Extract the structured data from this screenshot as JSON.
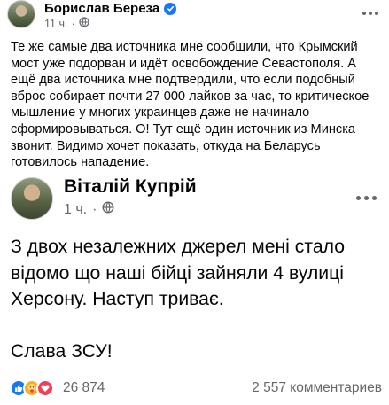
{
  "outer_post": {
    "author": "Борислав Береза",
    "time": "11 ч.",
    "text": "Те же самые два источника мне сообщили, что Крымский мост уже подорван и идёт освобождение Севастополя. А ещё два источника мне подтвердили, что если подобный вброс собирает почти 27 000 лайков за час, то критическое мышление у многих украинцев даже не начинало сформировываться. О! Тут ещё один источник из Минска звонит. Видимо хочет показать, откуда на Беларусь готовилось нападение.",
    "verified_icon": "verified-badge-icon",
    "privacy_icon": "globe-icon"
  },
  "shared_post": {
    "author": "Віталій Купрій",
    "time": "1 ч.",
    "privacy_icon": "globe-icon",
    "text_line1": "З двох незалежних джерел мені стало відомо що наші бійці зайняли 4 вулиці Херсону. Наступ триває.",
    "text_line2": "Слава ЗСУ!"
  },
  "reactions": {
    "icons": [
      "like-icon",
      "care-icon",
      "love-icon"
    ],
    "count": "26 874",
    "comments": "2 557 комментариев"
  },
  "colors": {
    "accent": "#1877f2",
    "secondary_text": "#65676b",
    "primary_text": "#050505"
  }
}
